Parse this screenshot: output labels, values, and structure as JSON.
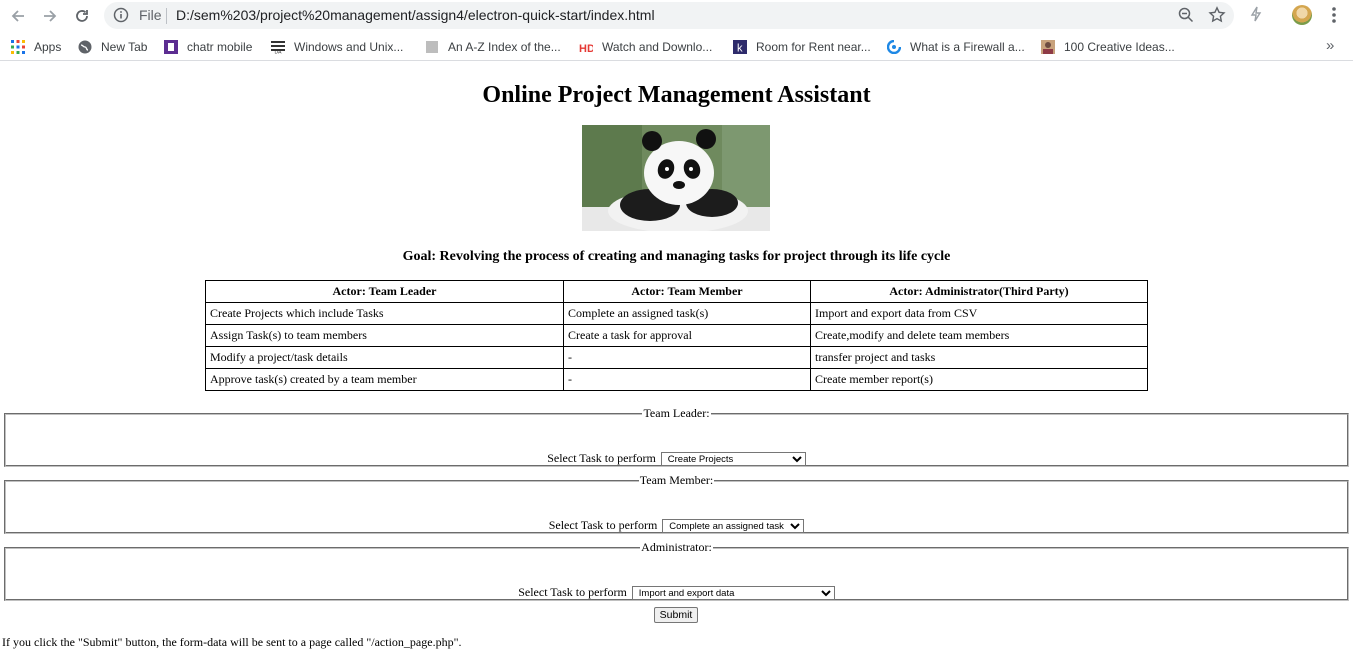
{
  "browser": {
    "scheme_label": "File",
    "url": "D:/sem%203/project%20management/assign4/electron-quick-start/index.html",
    "bookmarks": [
      {
        "label": "Apps",
        "icon": "apps-grid-icon"
      },
      {
        "label": "New Tab",
        "icon": "globe-icon"
      },
      {
        "label": "chatr mobile",
        "icon": "chatr-icon"
      },
      {
        "label": "Windows and Unix...",
        "icon": "ibm-icon"
      },
      {
        "label": "An A-Z Index of the...",
        "icon": "page-icon"
      },
      {
        "label": "Watch and Downlo...",
        "icon": "hd-icon"
      },
      {
        "label": "Room for Rent near...",
        "icon": "k-icon"
      },
      {
        "label": "What is a Firewall a...",
        "icon": "firewall-icon"
      },
      {
        "label": "100 Creative Ideas...",
        "icon": "photo-icon"
      }
    ],
    "bookmarks_more": "»",
    "colors": {
      "omnibox_bg": "#f1f3f4",
      "text": "#202124",
      "icon": "#5f6368"
    }
  },
  "page": {
    "title": "Online Project Management Assistant",
    "image_alt": "panda image",
    "goal": "Goal: Revolving the process of creating and managing tasks for project through its life cycle",
    "table": {
      "headers": [
        "Actor: Team Leader",
        "Actor: Team Member",
        "Actor: Administrator(Third Party)"
      ],
      "rows": [
        [
          "Create Projects which include Tasks",
          "Complete an assigned task(s)",
          "Import and export data from CSV"
        ],
        [
          "Assign Task(s) to team members",
          "Create a task for approval",
          "Create,modify and delete team members"
        ],
        [
          "Modify a project/task details",
          "-",
          "transfer project and tasks"
        ],
        [
          "Approve task(s) created by a team member",
          "-",
          "Create member report(s)"
        ]
      ]
    },
    "sections": [
      {
        "legend": "Team Leader:",
        "prompt": "Select Task to perform",
        "selected": "Create Projects"
      },
      {
        "legend": "Team Member:",
        "prompt": "Select Task to perform",
        "selected": "Complete an assigned task"
      },
      {
        "legend": "Administrator:",
        "prompt": "Select Task to perform",
        "selected": "Import and export data"
      }
    ],
    "submit_label": "Submit",
    "note": "If you click the \"Submit\" button, the form-data will be sent to a page called \"/action_page.php\"."
  }
}
